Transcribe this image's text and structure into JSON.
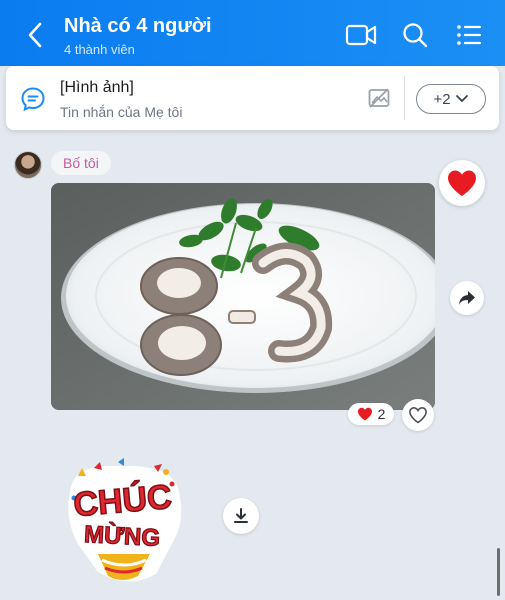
{
  "header": {
    "title": "Nhà có 4 người",
    "subtitle": "4 thành viên"
  },
  "pinned": {
    "title": "[Hình ảnh]",
    "subtitle": "Tin nhắn của Mẹ tôi",
    "more_label": "+2"
  },
  "message": {
    "sender": "Bố tôi",
    "photo_text": "8-3",
    "reaction_count": "2"
  },
  "sticker": {
    "line1": "CHÚC",
    "line2": "MỪNG"
  },
  "colors": {
    "header": "#0a7cf0",
    "accent": "#1a8cf5",
    "heart": "#e81b23",
    "sender": "#c55aa6"
  },
  "icons": [
    "back-arrow-icon",
    "video-call-icon",
    "search-icon",
    "menu-list-icon",
    "chat-bubble-icon",
    "image-off-icon",
    "chevron-down-icon",
    "heart-icon",
    "share-arrow-icon",
    "heart-outline-icon",
    "download-icon"
  ]
}
